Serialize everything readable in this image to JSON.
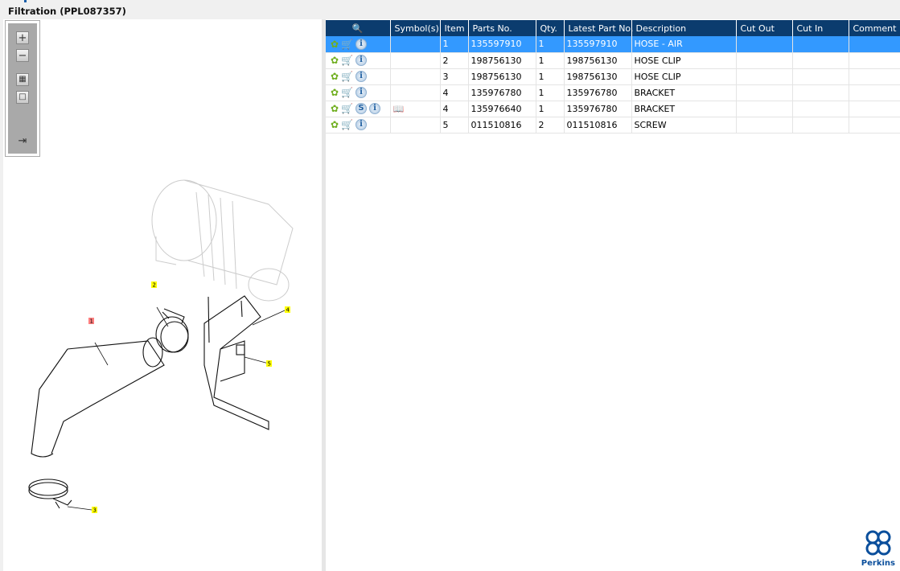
{
  "window": {
    "title": "Filtration (PPL087357)"
  },
  "toolbar": {
    "zoom_in": "zoom-in",
    "zoom_out": "zoom-out",
    "fit": "fit",
    "actual": "actual-size",
    "export": "export"
  },
  "diagram": {
    "callouts": [
      "1",
      "2",
      "3",
      "4",
      "5"
    ]
  },
  "table": {
    "headers": [
      "",
      "Symbol(s)",
      "Item",
      "Parts No.",
      "Qty.",
      "Latest Part No.",
      "Description",
      "Cut Out",
      "Cut In",
      "Comment"
    ],
    "rows": [
      {
        "item": "1",
        "part": "135597910",
        "qty": "1",
        "latest": "135597910",
        "desc": "HOSE - AIR",
        "selected": true,
        "s": false,
        "symbol": false
      },
      {
        "item": "2",
        "part": "198756130",
        "qty": "1",
        "latest": "198756130",
        "desc": "HOSE CLIP"
      },
      {
        "item": "3",
        "part": "198756130",
        "qty": "1",
        "latest": "198756130",
        "desc": "HOSE CLIP"
      },
      {
        "item": "4",
        "part": "135976780",
        "qty": "1",
        "latest": "135976780",
        "desc": "BRACKET"
      },
      {
        "item": "4",
        "part": "135976640",
        "qty": "1",
        "latest": "135976780",
        "desc": "BRACKET",
        "s": true,
        "symbol": true
      },
      {
        "item": "5",
        "part": "011510816",
        "qty": "2",
        "latest": "011510816",
        "desc": "SCREW"
      }
    ],
    "info_glyph": "i",
    "s_glyph": "S"
  },
  "logo": {
    "text": "Perkins"
  },
  "colors": {
    "header": "#0b3c6e",
    "selected": "#3399ff",
    "callout": "#ffff00",
    "callout_selected": "#ff8080"
  }
}
